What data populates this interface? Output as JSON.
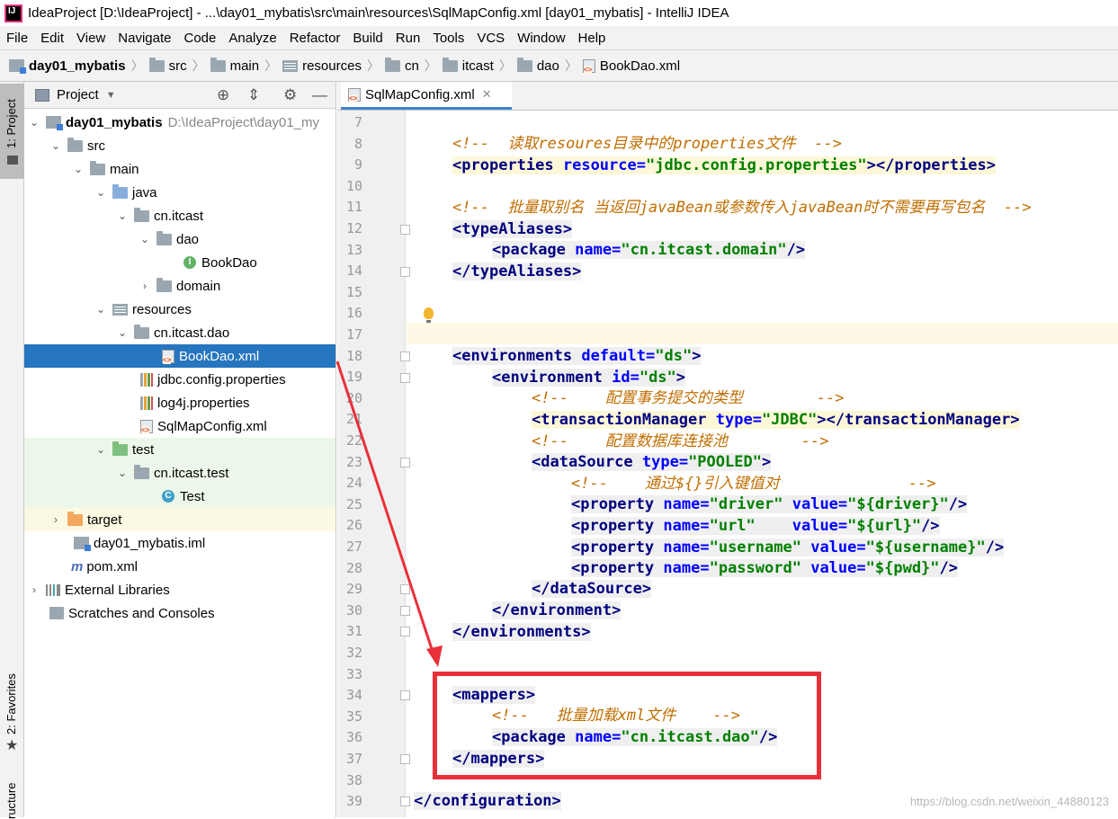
{
  "window": {
    "title": "IdeaProject [D:\\IdeaProject] - ...\\day01_mybatis\\src\\main\\resources\\SqlMapConfig.xml [day01_mybatis] - IntelliJ IDEA"
  },
  "menu": [
    "File",
    "Edit",
    "View",
    "Navigate",
    "Code",
    "Analyze",
    "Refactor",
    "Build",
    "Run",
    "Tools",
    "VCS",
    "Window",
    "Help"
  ],
  "breadcrumb": [
    "day01_mybatis",
    "src",
    "main",
    "resources",
    "cn",
    "itcast",
    "dao",
    "BookDao.xml"
  ],
  "left_strip": {
    "project": "1: Project",
    "favorites": "2: Favorites",
    "structure": "ructure"
  },
  "panel": {
    "title": "Project"
  },
  "tree": [
    {
      "label": "day01_mybatis",
      "path": "D:\\IdeaProject\\day01_my"
    },
    {
      "label": "src"
    },
    {
      "label": "main"
    },
    {
      "label": "java"
    },
    {
      "label": "cn.itcast"
    },
    {
      "label": "dao"
    },
    {
      "label": "BookDao"
    },
    {
      "label": "domain"
    },
    {
      "label": "resources"
    },
    {
      "label": "cn.itcast.dao"
    },
    {
      "label": "BookDao.xml"
    },
    {
      "label": "jdbc.config.properties"
    },
    {
      "label": "log4j.properties"
    },
    {
      "label": "SqlMapConfig.xml"
    },
    {
      "label": "test"
    },
    {
      "label": "cn.itcast.test"
    },
    {
      "label": "Test"
    },
    {
      "label": "target"
    },
    {
      "label": "day01_mybatis.iml"
    },
    {
      "label": "pom.xml"
    },
    {
      "label": "External Libraries"
    },
    {
      "label": "Scratches and Consoles"
    }
  ],
  "tab": {
    "label": "SqlMapConfig.xml"
  },
  "editor": {
    "line_numbers": [
      "7",
      "8",
      "9",
      "10",
      "11",
      "12",
      "13",
      "14",
      "15",
      "16",
      "17",
      "18",
      "19",
      "20",
      "21",
      "22",
      "23",
      "24",
      "25",
      "26",
      "27",
      "28",
      "29",
      "30",
      "31",
      "32",
      "33",
      "34",
      "35",
      "36",
      "37",
      "38",
      "39"
    ],
    "comments": {
      "l8": "<!--  读取resoures目录中的properties文件  -->",
      "l11": "<!--  批量取别名 当返回javaBean或参数传入javaBean时不需要再写包名  -->",
      "l20": "<!--    配置事务提交的类型        -->",
      "l22": "<!--    配置数据库连接池        -->",
      "l24": "<!--    通过${}引入键值对              -->",
      "l35": "<!--   批量加载xml文件    -->"
    },
    "tokens": {
      "properties": "properties",
      "resource_attr": "resource",
      "resource_val": "\"jdbc.config.properties\"",
      "typeAliases": "typeAliases",
      "package": "package",
      "name_attr": "name",
      "domain_val": "\"cn.itcast.domain\"",
      "environments": "environments",
      "default_attr": "default",
      "ds_val": "\"ds\"",
      "environment": "environment",
      "id_attr": "id",
      "transactionManager": "transactionManager",
      "type_attr": "type",
      "jdbc_val": "\"JDBC\"",
      "dataSource": "dataSource",
      "pooled_val": "\"POOLED\"",
      "property": "property",
      "value_attr": "value",
      "driver_name": "\"driver\"",
      "driver_val": "\"${driver}\"",
      "url_name": "\"url\"",
      "url_val": "\"${url}\"",
      "username_name": "\"username\"",
      "username_val": "\"${username}\"",
      "password_name": "\"password\"",
      "pwd_val": "\"${pwd}\"",
      "mappers": "mappers",
      "dao_val": "\"cn.itcast.dao\"",
      "configuration": "configuration"
    }
  },
  "watermark": "https://blog.csdn.net/weixin_44880123",
  "colors": {
    "selection": "#2675bf",
    "annotation_red": "#e8303a",
    "tag": "#000080",
    "attr": "#0000ff",
    "value": "#008000",
    "comment": "#c06e00"
  }
}
